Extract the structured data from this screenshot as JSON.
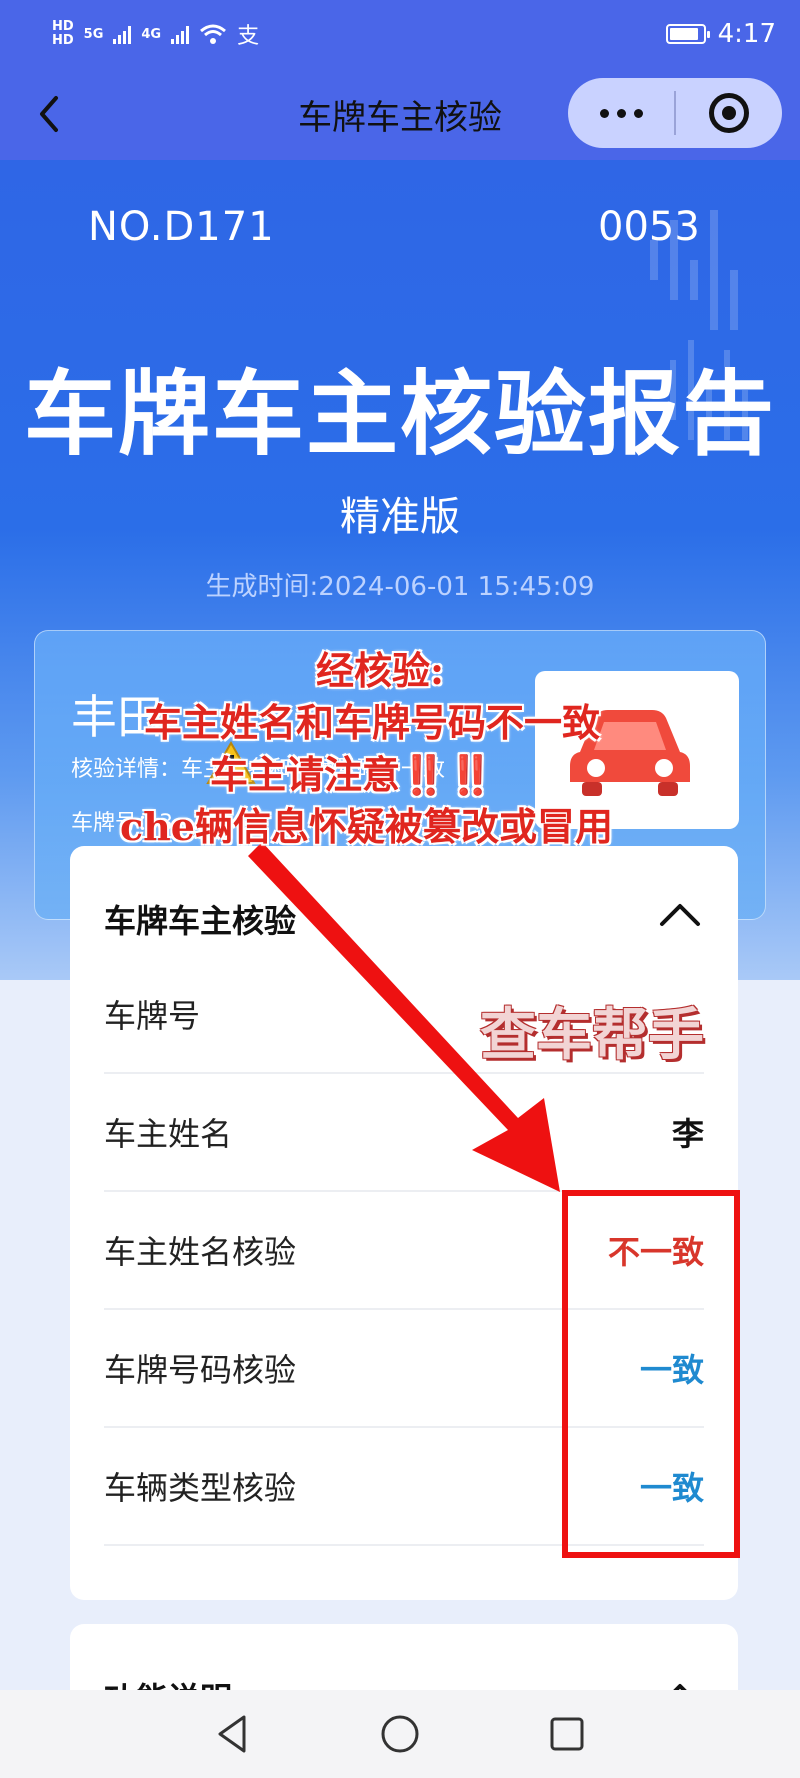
{
  "status_bar": {
    "network_top": "HD",
    "network_bottom": "HD",
    "gen_5g": "5G",
    "gen_4g": "4G",
    "extra_icon": "支",
    "time": "4:17"
  },
  "nav": {
    "title": "车牌车主核验"
  },
  "hero": {
    "report_no_start": "NO.D171",
    "report_no_end": "0053",
    "title": "车牌车主核验报告",
    "edition": "精准版",
    "generated": "生成时间:2024-06-01 15:45:09"
  },
  "summary": {
    "brand": "丰田",
    "detail": "核验详情：车主姓名和车牌号码不一致",
    "plate": "车牌号：3"
  },
  "annotation": {
    "line1": "经核验:",
    "line2": "车主姓名和车牌号码不一致",
    "line3": "车主请注意‼️‼️",
    "line4": "che辆信息怀疑被篡改或冒用",
    "watermark": "查车帮手"
  },
  "details_card": {
    "title": "车牌车主核验",
    "rows": [
      {
        "label": "车牌号",
        "value": ""
      },
      {
        "label": "车主姓名",
        "value": "李"
      },
      {
        "label": "车主姓名核验",
        "value": "不一致"
      },
      {
        "label": "车牌号码核验",
        "value": "一致"
      },
      {
        "label": "车辆类型核验",
        "value": "一致"
      }
    ]
  },
  "function_card": {
    "title": "功能说明"
  },
  "colors": {
    "primary": "#4a66e8",
    "mismatch": "#d8362b",
    "match": "#1f8ad0",
    "highlight": "#ee1111"
  },
  "icons": [
    "back-icon",
    "more-icon",
    "target-icon",
    "warning-icon",
    "car-icon",
    "chevron-up-icon",
    "nav-back-icon",
    "nav-home-icon",
    "nav-recents-icon"
  ]
}
